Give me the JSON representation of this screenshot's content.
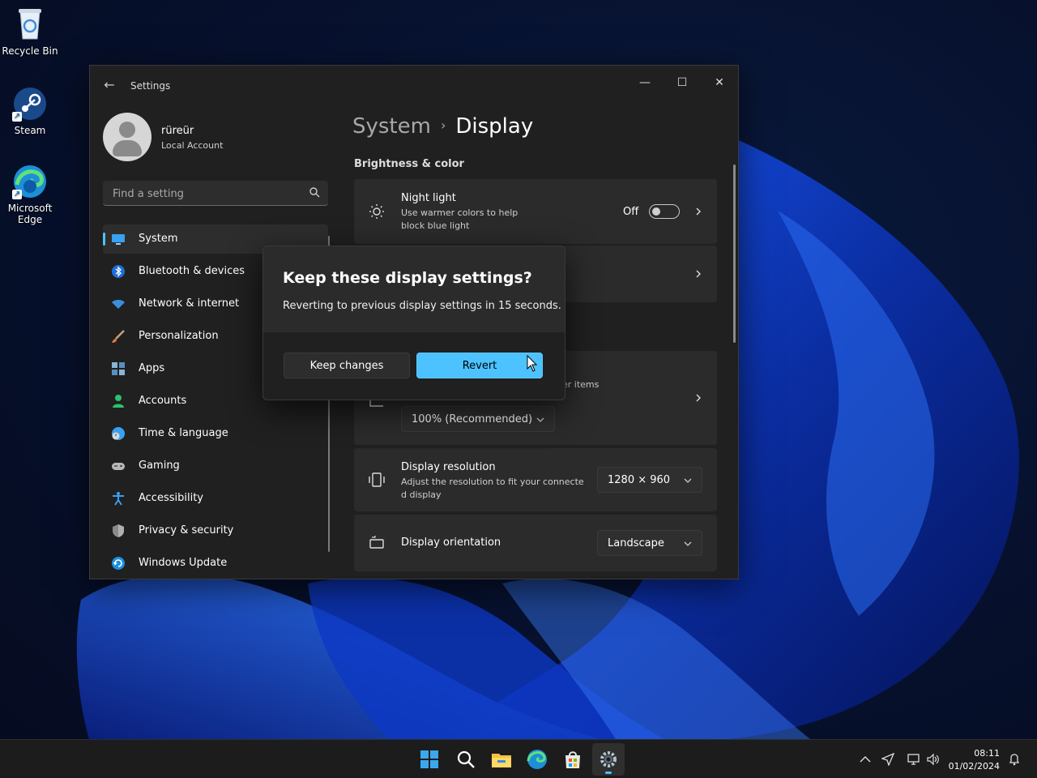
{
  "desktop": {
    "icons": [
      {
        "label": "Recycle Bin"
      },
      {
        "label": "Steam"
      },
      {
        "label": "Microsoft Edge"
      }
    ]
  },
  "window": {
    "app_title": "Settings",
    "controls": {
      "minimize": "—",
      "maximize": "☐",
      "close": "✕"
    }
  },
  "profile": {
    "name": "rüreür",
    "account_type": "Local Account"
  },
  "search": {
    "placeholder": "Find a setting"
  },
  "nav": {
    "items": [
      {
        "label": "System",
        "active": true
      },
      {
        "label": "Bluetooth & devices"
      },
      {
        "label": "Network & internet"
      },
      {
        "label": "Personalization"
      },
      {
        "label": "Apps"
      },
      {
        "label": "Accounts"
      },
      {
        "label": "Time & language"
      },
      {
        "label": "Gaming"
      },
      {
        "label": "Accessibility"
      },
      {
        "label": "Privacy & security"
      },
      {
        "label": "Windows Update"
      }
    ]
  },
  "breadcrumb": {
    "parent": "System",
    "separator": "›",
    "current": "Display"
  },
  "content": {
    "section_brightness": "Brightness & color",
    "night_light": {
      "title": "Night light",
      "desc_line1": "Use warmer colors to help",
      "desc_line2": "block blue light",
      "state": "Off"
    },
    "scale": {
      "desc_fragment": "her items",
      "value": "100% (Recommended)"
    },
    "resolution": {
      "title": "Display resolution",
      "desc_line1": "Adjust the resolution to fit your connecte",
      "desc_line2": "d display",
      "value": "1280 × 960"
    },
    "orientation": {
      "title": "Display orientation",
      "value": "Landscape"
    }
  },
  "dialog": {
    "title": "Keep these display settings?",
    "body": "Reverting to previous display settings in 15 seconds.",
    "keep_label": "Keep changes",
    "revert_label": "Revert"
  },
  "taskbar": {
    "clock_time": "08:11",
    "clock_date": "01/02/2024",
    "accent": "#4cc2ff"
  }
}
